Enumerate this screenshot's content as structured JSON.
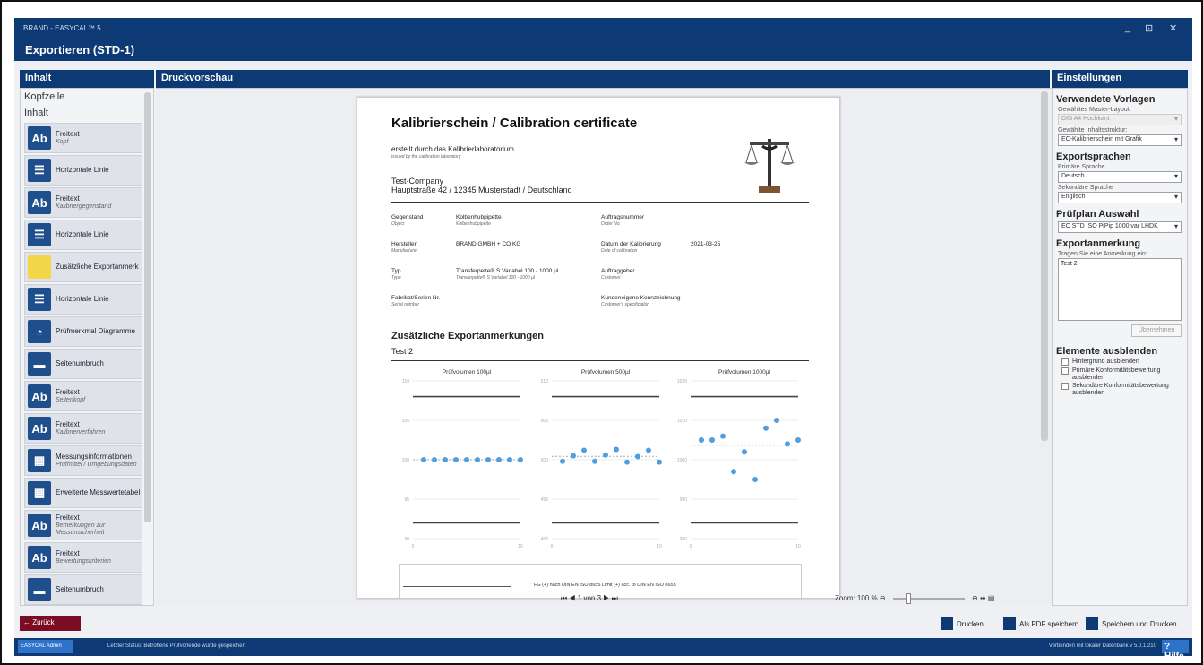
{
  "window": {
    "app_title": "BRAND - EASYCAL™ 5",
    "title": "Exportieren (STD-1)",
    "controls": {
      "minimize": "_",
      "restore": "⊡",
      "close": "✕"
    }
  },
  "left": {
    "header": "Inhalt",
    "sections": [
      "Kopfzeile",
      "Inhalt"
    ],
    "items": [
      {
        "label": "Freitext",
        "sub": "Kopf",
        "icon": "text-icon",
        "color": "#1f4e8c"
      },
      {
        "label": "Horizontale Linie",
        "sub": "",
        "icon": "line-icon",
        "color": "#1f4e8c"
      },
      {
        "label": "Freitext",
        "sub": "Kalibriergegenstand",
        "icon": "text-icon",
        "color": "#1f4e8c"
      },
      {
        "label": "Horizontale Linie",
        "sub": "",
        "icon": "line-icon",
        "color": "#1f4e8c"
      },
      {
        "label": "Zusätzliche Exportanmerk",
        "sub": "",
        "icon": "note-icon",
        "color": "#f2d64a"
      },
      {
        "label": "Horizontale Linie",
        "sub": "",
        "icon": "line-icon",
        "color": "#1f4e8c"
      },
      {
        "label": "Prüfmerkmal Diagramme",
        "sub": "",
        "icon": "pie-chart-icon",
        "color": "#1f4e8c"
      },
      {
        "label": "Seitenumbruch",
        "sub": "",
        "icon": "page-break-icon",
        "color": "#1f4e8c"
      },
      {
        "label": "Freitext",
        "sub": "Seitenkopf",
        "icon": "text-icon",
        "color": "#1f4e8c"
      },
      {
        "label": "Freitext",
        "sub": "Kalibrierverfahren",
        "icon": "text-icon",
        "color": "#1f4e8c"
      },
      {
        "label": "Messungsinformationen",
        "sub": "Prüfmittel / Umgebungsdaten",
        "icon": "table-icon",
        "color": "#1f4e8c"
      },
      {
        "label": "Erweiterte Messwertetabel",
        "sub": "",
        "icon": "grid-icon",
        "color": "#1f4e8c"
      },
      {
        "label": "Freitext",
        "sub": "Bemerkungen zur Messunsicherheit",
        "icon": "text-icon",
        "color": "#1f4e8c"
      },
      {
        "label": "Freitext",
        "sub": "Bewertungskriterien",
        "icon": "text-icon",
        "color": "#1f4e8c"
      },
      {
        "label": "Seitenumbruch",
        "sub": "",
        "icon": "page-break-icon",
        "color": "#1f4e8c"
      }
    ]
  },
  "center": {
    "header": "Druckvorschau",
    "nav": "⏮  ◀  1 von 3  ▶  ⏭",
    "zoom": "Zoom: 100 %",
    "zoom_value": 100
  },
  "doc": {
    "title": "Kalibrierschein / Calibration certificate",
    "by": "erstellt durch das Kalibrierlaboratorium",
    "by_en": "issued by the calibration laboratory",
    "company": "Test-Company",
    "address": "Hauptstraße 42 / 12345 Musterstadt / Deutschland",
    "fields": [
      {
        "k": "Gegenstand",
        "ke": "Object",
        "v": "Kolbenhubpipette",
        "ve": "Kolbenhubpipette"
      },
      {
        "k": "Auftragsnummer",
        "ke": "Order No.",
        "v": "",
        "ve": ""
      },
      {
        "k": "Hersteller",
        "ke": "Manufacturer",
        "v": "BRAND GMBH + CO KG",
        "ve": ""
      },
      {
        "k": "Datum der Kalibrierung",
        "ke": "Date of calibration",
        "v": "2021-03-25",
        "ve": ""
      },
      {
        "k": "Typ",
        "ke": "Type",
        "v": "Transferpette® S Variabel 100 - 1000 µl",
        "ve": "Transferpette® S Variabel 100 - 1000 µl"
      },
      {
        "k": "Auftraggeber",
        "ke": "Customer",
        "v": "",
        "ve": ""
      },
      {
        "k": "Fabrikat/Serien Nr.",
        "ke": "Serial number",
        "v": "",
        "ve": ""
      },
      {
        "k": "Kundeneigene Kennzeichnung",
        "ke": "Customer's specification",
        "v": "",
        "ve": ""
      }
    ],
    "section": "Zusätzliche Exportanmerkungen",
    "note": "Test 2",
    "legend": "FG (+) nach DIN EN ISO 8655      Limit (+) acc. to DIN EN ISO 8655"
  },
  "chart_data": [
    {
      "type": "scatter",
      "title": "Prüfvolumen 100µl",
      "xlim": [
        0,
        10
      ],
      "ylim": [
        90,
        110
      ],
      "yticks": [
        "110",
        "105",
        "100",
        "95",
        "90"
      ],
      "xticks": [
        "0",
        "10"
      ],
      "limits": [
        108,
        92
      ],
      "points": [
        [
          1,
          100
        ],
        [
          2,
          100
        ],
        [
          3,
          100
        ],
        [
          4,
          100
        ],
        [
          5,
          100
        ],
        [
          6,
          100
        ],
        [
          7,
          100
        ],
        [
          8,
          100
        ],
        [
          9,
          100
        ],
        [
          10,
          100
        ]
      ]
    },
    {
      "type": "scatter",
      "title": "Prüfvolumen 500µl",
      "xlim": [
        0,
        10
      ],
      "ylim": [
        490,
        510
      ],
      "yticks": [
        "510",
        "505",
        "500",
        "495",
        "490"
      ],
      "xticks": [
        "0",
        "10"
      ],
      "limits": [
        508,
        492
      ],
      "points": [
        [
          1,
          499.8
        ],
        [
          2,
          500.5
        ],
        [
          3,
          501.2
        ],
        [
          4,
          499.8
        ],
        [
          5,
          500.6
        ],
        [
          6,
          501.3
        ],
        [
          7,
          499.7
        ],
        [
          8,
          500.4
        ],
        [
          9,
          501.2
        ],
        [
          10,
          499.7
        ]
      ]
    },
    {
      "type": "scatter",
      "title": "Prüfvolumen 1000µl",
      "xlim": [
        0,
        10
      ],
      "ylim": [
        980,
        1020
      ],
      "yticks": [
        "1020",
        "1010",
        "1000",
        "990",
        "980"
      ],
      "xticks": [
        "0",
        "10"
      ],
      "limits": [
        1016,
        984
      ],
      "points": [
        [
          1,
          1005
        ],
        [
          2,
          1005
        ],
        [
          3,
          1006
        ],
        [
          4,
          997
        ],
        [
          5,
          1002
        ],
        [
          6,
          995
        ],
        [
          7,
          1008
        ],
        [
          8,
          1010
        ],
        [
          9,
          1004
        ],
        [
          10,
          1005
        ]
      ]
    }
  ],
  "right": {
    "header": "Einstellungen",
    "vorlagen": "Verwendete Vorlagen",
    "master_label": "Gewähltes Master-Layout:",
    "master_value": "DIN A4 Hochkant",
    "struktur_label": "Gewählte Inhaltsstruktur:",
    "struktur_value": "EC-Kalibrierschein mit Grafik",
    "sprachen": "Exportsprachen",
    "primaer_label": "Primäre Sprache",
    "primaer_value": "Deutsch",
    "sekundaer_label": "Sekundäre Sprache",
    "sekundaer_value": "Englisch",
    "pruefplan": "Prüfplan Auswahl",
    "pruefplan_value": "EC STD ISO PiPip 1000 var LHDK",
    "anmerkung": "Exportanmerkung",
    "anmerkung_label": "Tragen Sie eine Anmerkung ein:",
    "anmerkung_value": "Test 2",
    "apply": "Übernehmen",
    "ausblenden": "Elemente ausblenden",
    "checks": [
      "Hintergrund ausblenden",
      "Primäre Konformitätsbewertung ausblenden",
      "Sekundäre Konformitätsbewertung ausblenden"
    ]
  },
  "bottom": {
    "back": "Zurück",
    "print": "Drucken",
    "pdf": "Als PDF speichern",
    "save_print": "Speichern und Drucken"
  },
  "status": {
    "user": "EASYCAL Admin",
    "message": "Letzter Status: Betroffene Prüfvorlende wurde gespeichert",
    "right": "Verbunden mit lokaler Datenbank   v 5.0.1.210",
    "help": "? Hilfe"
  }
}
